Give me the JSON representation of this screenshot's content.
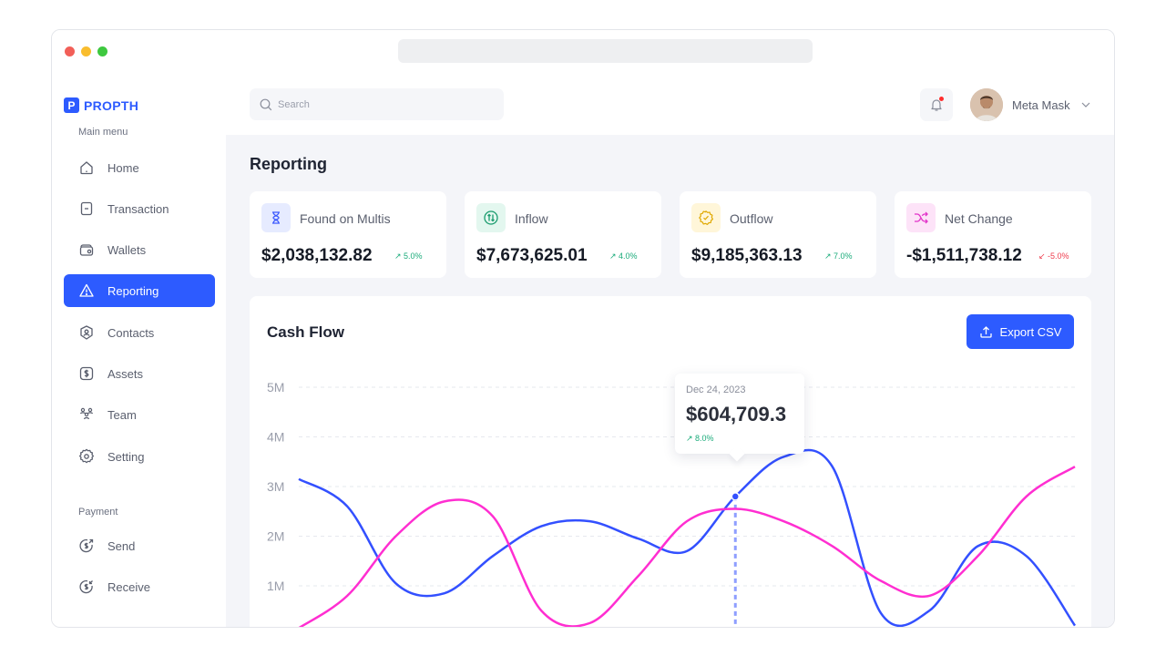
{
  "brand": {
    "mark": "P",
    "name": "PROPTH"
  },
  "sidebar": {
    "main_title": "Main menu",
    "items": [
      {
        "label": "Home",
        "icon": "home-icon"
      },
      {
        "label": "Transaction",
        "icon": "receipt-icon"
      },
      {
        "label": "Wallets",
        "icon": "wallet-icon"
      },
      {
        "label": "Reporting",
        "icon": "warning-icon",
        "active": true
      },
      {
        "label": "Contacts",
        "icon": "contact-icon"
      },
      {
        "label": "Assets",
        "icon": "dollar-square-icon"
      },
      {
        "label": "Team",
        "icon": "team-icon"
      },
      {
        "label": "Setting",
        "icon": "gear-icon"
      }
    ],
    "payment_title": "Payment",
    "payment_items": [
      {
        "label": "Send",
        "icon": "send-money-icon"
      },
      {
        "label": "Receive",
        "icon": "receive-money-icon"
      }
    ]
  },
  "search": {
    "placeholder": "Search"
  },
  "user": {
    "name": "Meta Mask"
  },
  "page": {
    "title": "Reporting"
  },
  "stats": [
    {
      "label": "Found on Multis",
      "value": "$2,038,132.82",
      "change": "5.0%",
      "direction": "up",
      "icon": "hourglass-icon",
      "color": "#3d5afe"
    },
    {
      "label": "Inflow",
      "value": "$7,673,625.01",
      "change": "4.0%",
      "direction": "up",
      "icon": "transfer-icon",
      "color": "#1aab7a"
    },
    {
      "label": "Outflow",
      "value": "$9,185,363.13",
      "change": "7.0%",
      "direction": "up",
      "icon": "badge-icon",
      "color": "#e0a800"
    },
    {
      "label": "Net Change",
      "value": "-$1,511,738.12",
      "change": "-5.0%",
      "direction": "down",
      "icon": "shuffle-icon",
      "color": "#e233c9"
    }
  ],
  "chart_card": {
    "title": "Cash Flow",
    "export_label": "Export CSV"
  },
  "tooltip": {
    "date": "Dec 24, 2023",
    "value": "$604,709.3",
    "change": "8.0%"
  },
  "chart_data": {
    "type": "line",
    "title": "Cash Flow",
    "y_ticks": [
      "5M",
      "4M",
      "3M",
      "2M",
      "1M"
    ],
    "ylim": [
      0,
      5
    ],
    "x": [
      0,
      1,
      2,
      3,
      4,
      5,
      6,
      7,
      8,
      9,
      10,
      11,
      12,
      13,
      14,
      15,
      16
    ],
    "xlim": [
      0,
      16
    ],
    "series": [
      {
        "color": "#3350ff",
        "values": [
          3.15,
          2.6,
          1.05,
          0.85,
          1.6,
          2.2,
          2.3,
          1.95,
          1.7,
          2.8,
          3.6,
          3.4,
          0.45,
          0.5,
          1.8,
          1.6,
          0.2
        ]
      },
      {
        "color": "#ff2ed1",
        "values": [
          0.15,
          0.8,
          2.0,
          2.7,
          2.4,
          0.5,
          0.25,
          1.2,
          2.3,
          2.55,
          2.3,
          1.8,
          1.1,
          0.8,
          1.6,
          2.8,
          3.4
        ]
      }
    ],
    "grid": true,
    "highlight": {
      "series": 0,
      "x": 9
    }
  }
}
